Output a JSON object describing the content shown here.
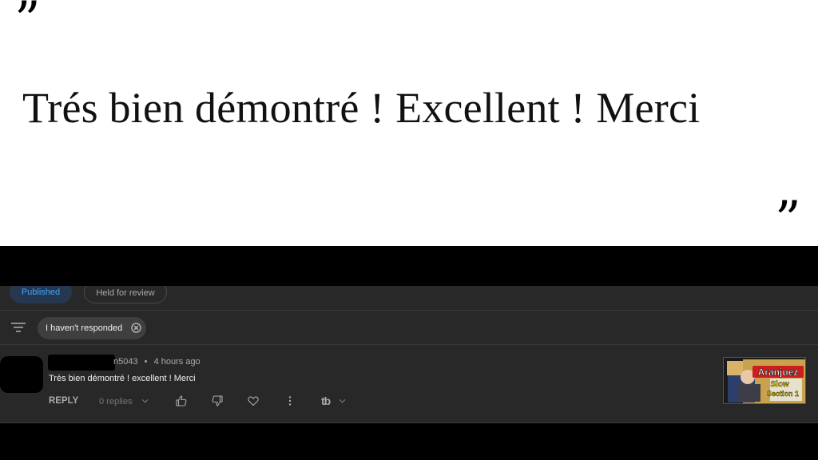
{
  "slide": {
    "open_quote": "”",
    "close_quote": "”",
    "quote": "Trés bien démontré ! Excellent ! Merci"
  },
  "tabs": {
    "published": "Published",
    "held": "Held for review"
  },
  "filter": {
    "icon": "filter-icon",
    "chip_label": "I haven't responded"
  },
  "comment": {
    "author_suffix": "n5043",
    "separator": "•",
    "time": "4 hours ago",
    "text": "Très bien démontré ! excellent ! Merci",
    "reply_label": "REPLY",
    "replies_label": "0 replies",
    "tb_label": "tb",
    "thumbnail": {
      "line1": "Aranjuez",
      "line2": "Slow",
      "line3": "Section 1"
    }
  },
  "colors": {
    "accent": "#3ea6ff",
    "panel_bg": "#282828",
    "band_bg": "#000000"
  }
}
